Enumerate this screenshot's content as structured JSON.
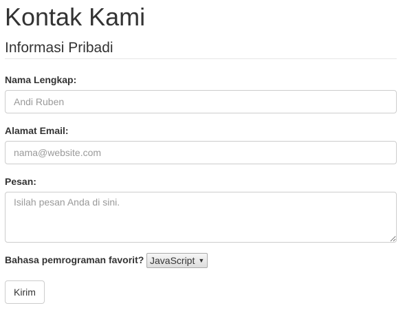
{
  "title": "Kontak Kami",
  "section": "Informasi Pribadi",
  "fields": {
    "name": {
      "label": "Nama Lengkap:",
      "placeholder": "Andi Ruben",
      "value": ""
    },
    "email": {
      "label": "Alamat Email:",
      "placeholder": "nama@website.com",
      "value": ""
    },
    "message": {
      "label": "Pesan:",
      "placeholder": "Isilah pesan Anda di sini.",
      "value": ""
    }
  },
  "language": {
    "label": "Bahasa pemrograman favorit?",
    "selected": "JavaScript",
    "arrow": "▼"
  },
  "submit_label": "Kirim"
}
